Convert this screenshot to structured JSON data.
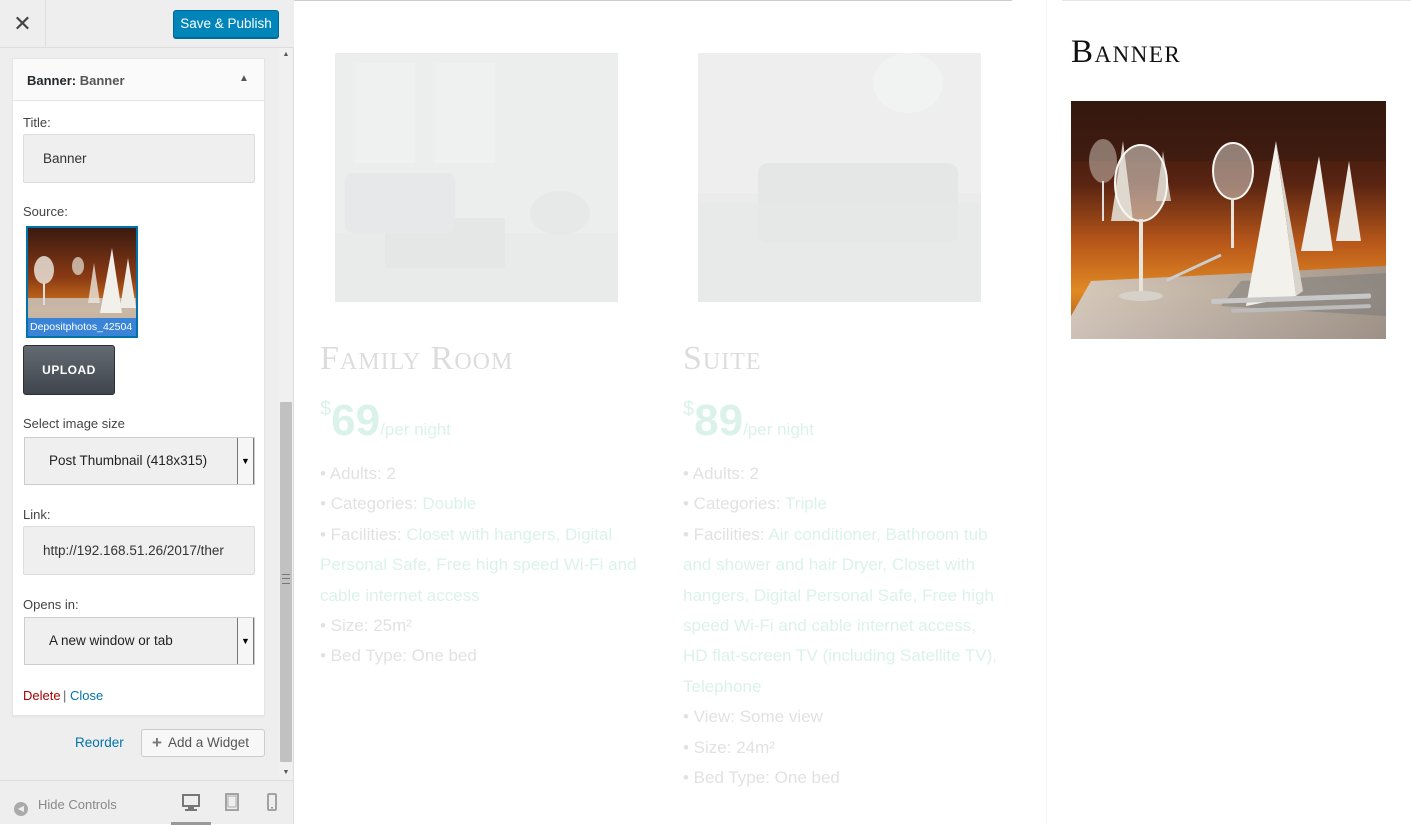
{
  "topbar": {
    "close_icon": "close-icon",
    "save_label": "Save & Publish"
  },
  "widget": {
    "header_type": "Banner:",
    "header_name": "Banner",
    "title_label": "Title:",
    "title_value": "Banner",
    "source_label": "Source:",
    "source_file": "Depositphotos_42504",
    "upload_label": "UPLOAD",
    "size_label": "Select image size",
    "size_value": "Post Thumbnail (418x315)",
    "link_label": "Link:",
    "link_value": "http://192.168.51.26/2017/ther",
    "opens_label": "Opens in:",
    "opens_value": "A new window or tab",
    "delete_label": "Delete",
    "separator": "|",
    "close_label": "Close"
  },
  "panel_actions": {
    "reorder_label": "Reorder",
    "add_widget_label": "Add a Widget"
  },
  "footer": {
    "hide_controls_label": "Hide Controls",
    "devices": [
      "desktop-icon",
      "tablet-icon",
      "mobile-icon"
    ],
    "active_device": "desktop"
  },
  "preview": {
    "rooms": [
      {
        "name": "Family Room",
        "currency": "$",
        "price": "69",
        "per": "/per night",
        "adults_label": "• Adults:",
        "adults": "2",
        "categories_label": "• Categories:",
        "categories": "Double",
        "facilities_label": "• Facilities:",
        "facilities": "Closet with hangers, Digital Personal Safe, Free high speed Wi-Fi and cable internet access",
        "size_label": "• Size:",
        "size": "25m²",
        "bed_label": "• Bed Type:",
        "bed": "One bed"
      },
      {
        "name": "Suite",
        "currency": "$",
        "price": "89",
        "per": "/per night",
        "adults_label": "• Adults:",
        "adults": "2",
        "categories_label": "• Categories:",
        "categories": "Triple",
        "facilities_label": "• Facilities:",
        "facilities": "Air conditioner, Bathroom tub and shower and hair Dryer, Closet with hangers, Digital Personal Safe, Free high speed Wi-Fi and cable internet access, HD flat-screen TV (including Satellite TV), Telephone",
        "view_label": "• View:",
        "view": "Some view",
        "size_label": "• Size:",
        "size": "24m²",
        "bed_label": "• Bed Type:",
        "bed": "One bed"
      }
    ],
    "banner_title": "Banner"
  },
  "colors": {
    "accent": "#0085ba",
    "price_green": "#00a870",
    "delete_red": "#aa0000",
    "link_blue": "#0073aa"
  }
}
